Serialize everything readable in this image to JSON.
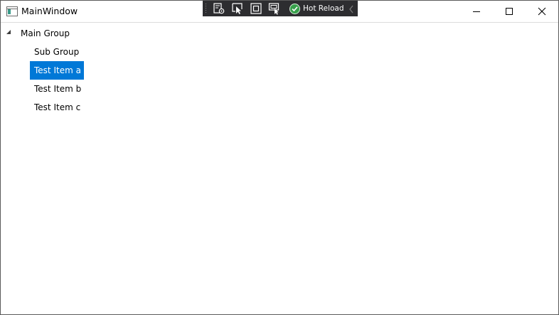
{
  "window": {
    "title": "MainWindow"
  },
  "devtools": {
    "hot_reload_label": "Hot Reload"
  },
  "tree": {
    "main_group": "Main Group",
    "sub_group": "Sub Group",
    "items": [
      "Test Item a",
      "Test Item b",
      "Test Item c"
    ],
    "selected_index": 0
  },
  "colors": {
    "selection": "#0078d7",
    "toolbar_bg": "#2d2d30",
    "hot_reload_ok": "#37a04b"
  }
}
